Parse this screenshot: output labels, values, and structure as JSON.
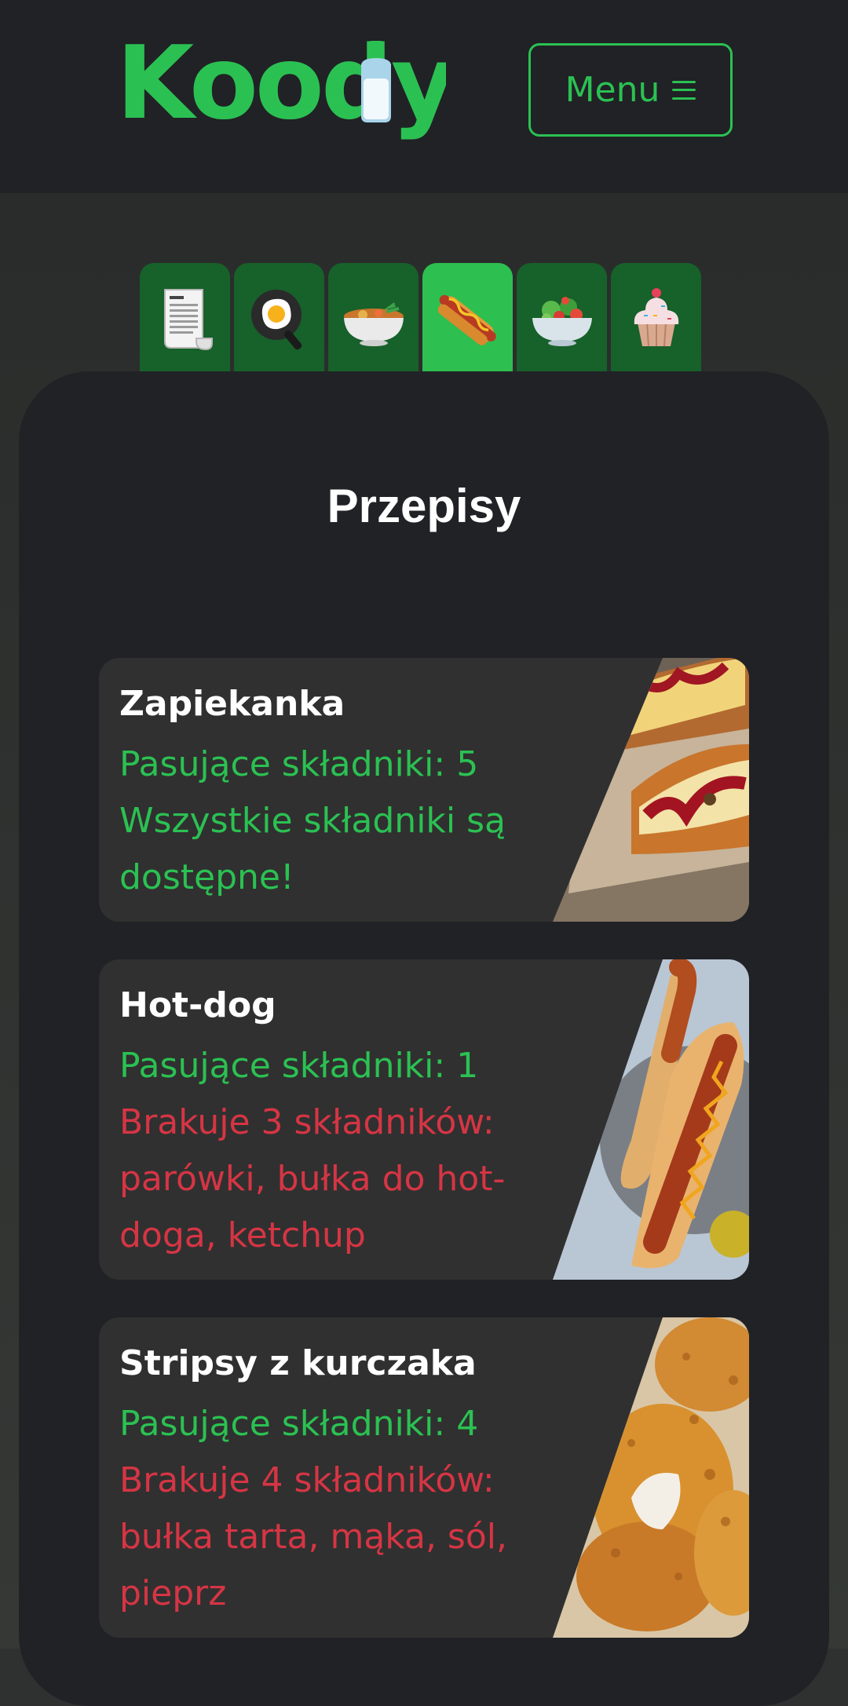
{
  "header": {
    "logo_text": "Koodly",
    "menu_label": "Menu",
    "brand_color": "#2bc152"
  },
  "tabs": [
    {
      "name": "recipes-scroll-icon",
      "active": false
    },
    {
      "name": "fried-egg-icon",
      "active": false
    },
    {
      "name": "bowl-of-soup-icon",
      "active": false
    },
    {
      "name": "hot-dog-icon",
      "active": true
    },
    {
      "name": "salad-icon",
      "active": false
    },
    {
      "name": "cupcake-icon",
      "active": false
    }
  ],
  "main": {
    "title": "Przepisy"
  },
  "recipes": [
    {
      "name": "Zapiekanka",
      "matching": "Pasujące składniki: 5",
      "status": "Wszystkie składniki są dostępne!",
      "missing": ""
    },
    {
      "name": "Hot-dog",
      "matching": "Pasujące składniki: 1",
      "status": "",
      "missing": "Brakuje 3 składników: parówki, bułka do hot-doga, ketchup"
    },
    {
      "name": "Stripsy z kurczaka",
      "matching": "Pasujące składniki: 4",
      "status": "",
      "missing": "Brakuje 4 składników: bułka tarta, mąka, sól, pieprz"
    }
  ],
  "colors": {
    "match": "#2bc152",
    "missing": "#d63544",
    "panel": "#212226",
    "card": "#303030"
  }
}
